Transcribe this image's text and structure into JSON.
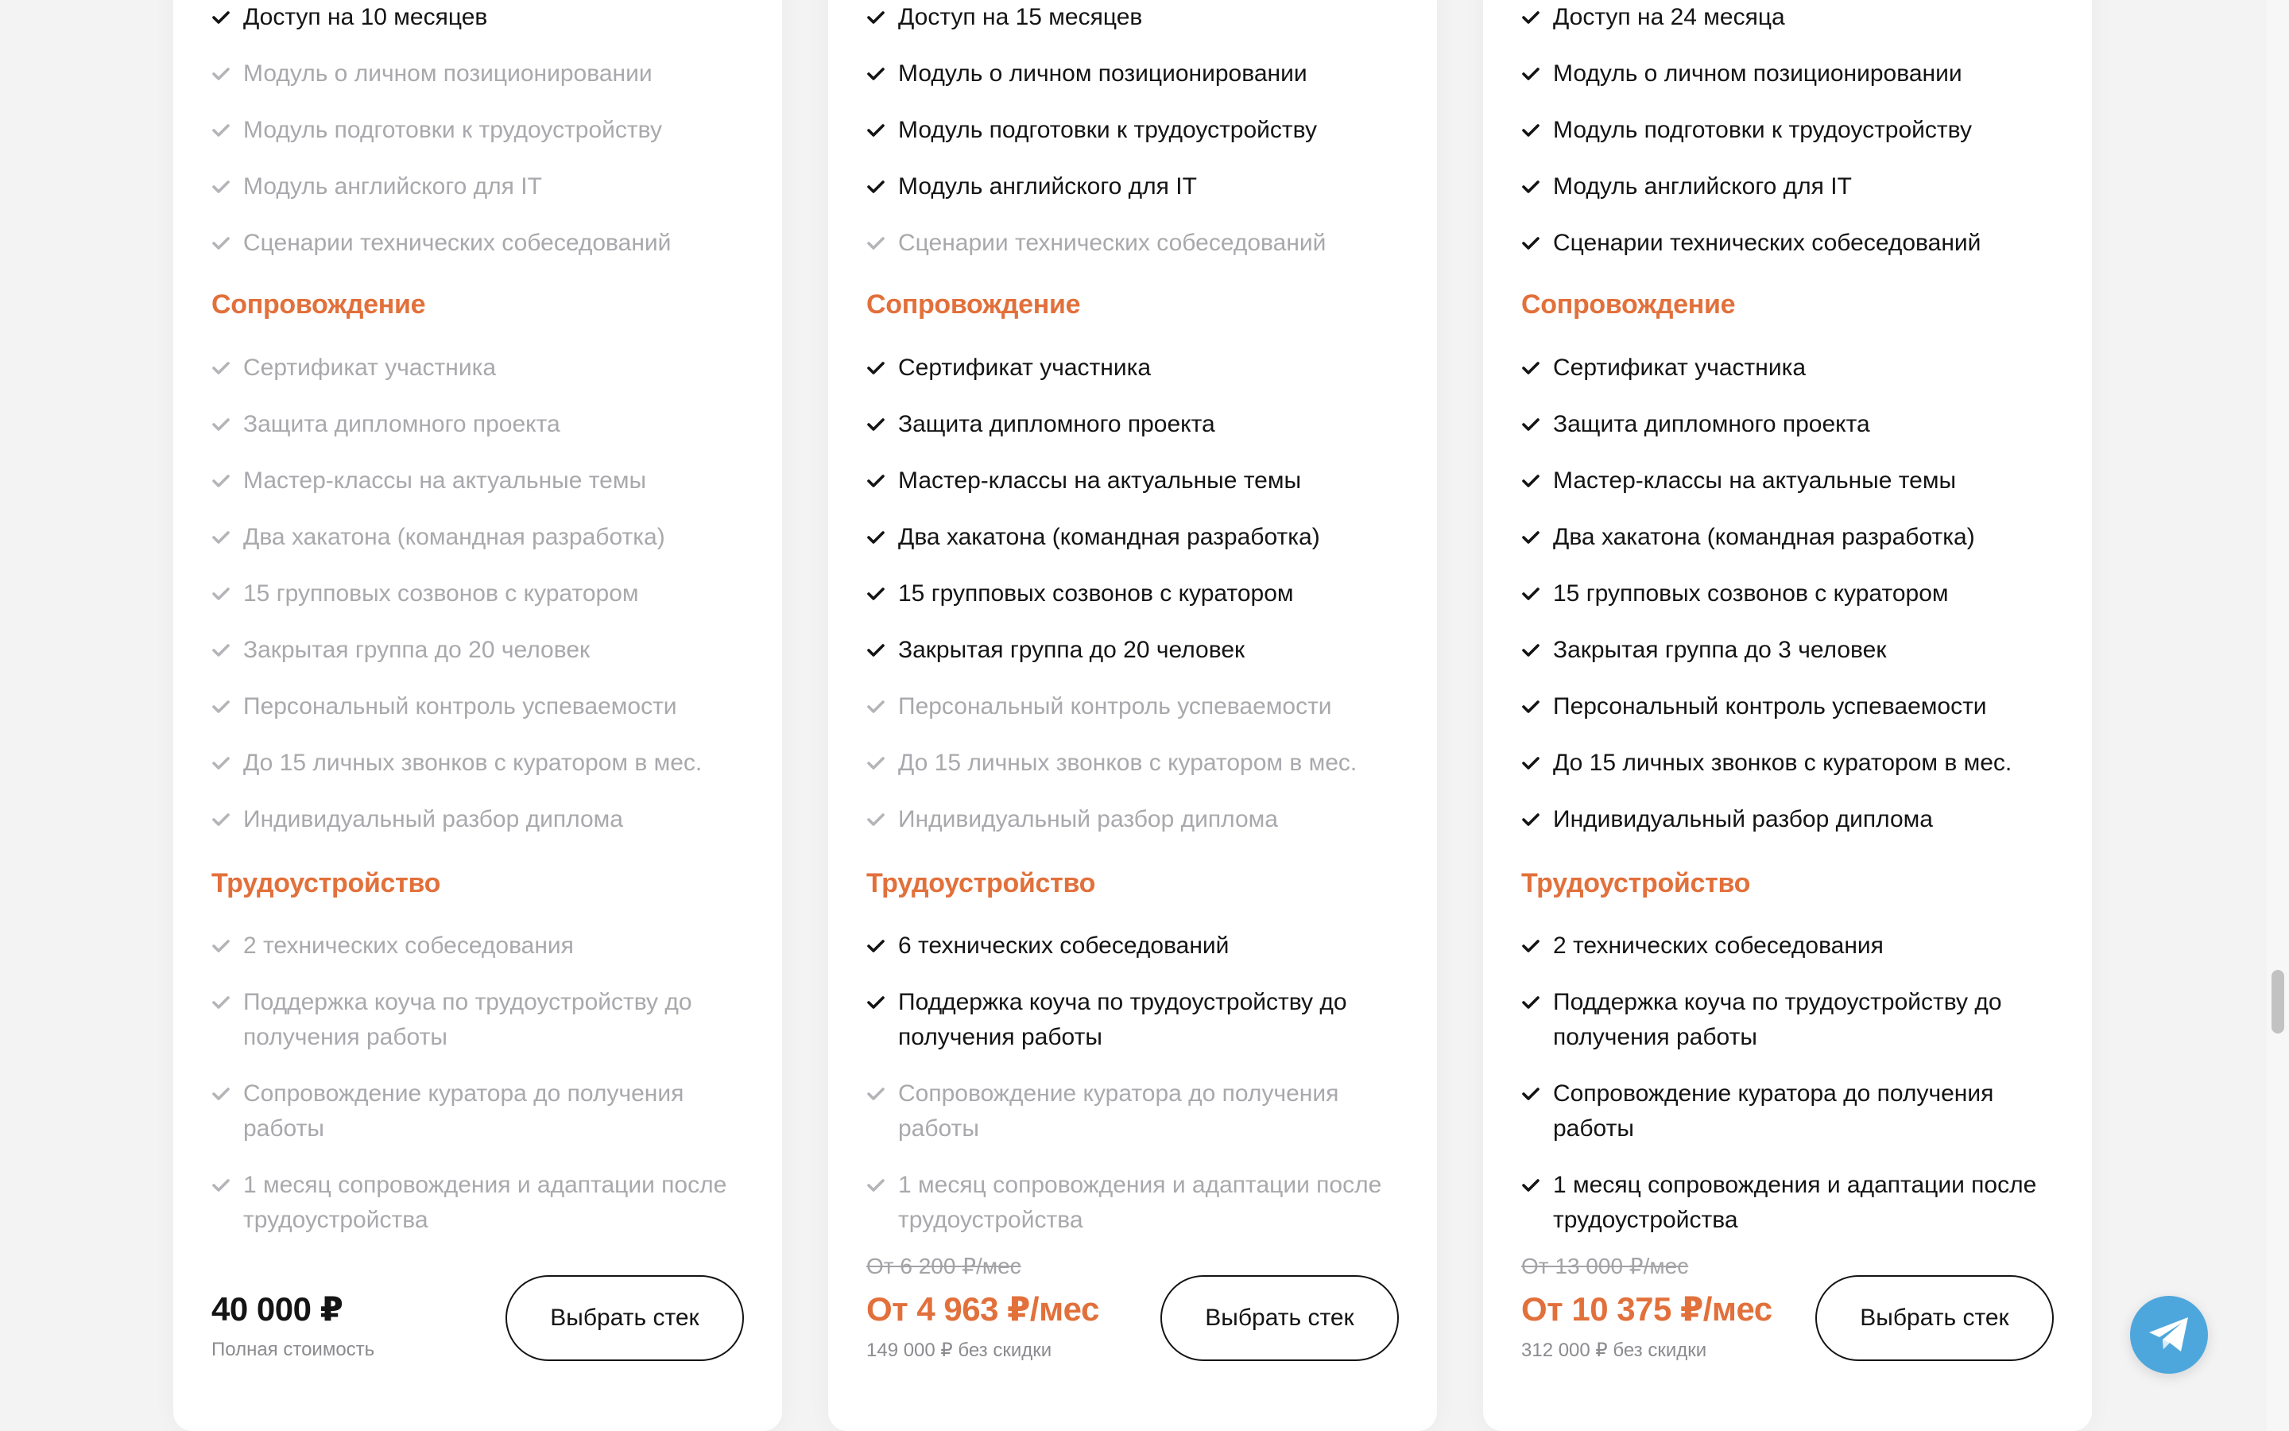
{
  "sections": {
    "support": "Сопровождение",
    "employment": "Трудоустройство"
  },
  "plans": [
    {
      "access": {
        "text": "Доступ на 10 месяцев",
        "on": true
      },
      "intro": [
        {
          "text": "Модуль о личном позиционировании",
          "on": false
        },
        {
          "text": "Модуль подготовки к трудоустройству",
          "on": false
        },
        {
          "text": "Модуль английского для IT",
          "on": false
        },
        {
          "text": "Сценарии технических собеседований",
          "on": false
        }
      ],
      "support": [
        {
          "text": "Сертификат участника",
          "on": false
        },
        {
          "text": "Защита дипломного проекта",
          "on": false
        },
        {
          "text": "Мастер-классы на актуальные темы",
          "on": false
        },
        {
          "text": "Два хакатона (командная разработка)",
          "on": false
        },
        {
          "text": "15 групповых созвонов с куратором",
          "on": false
        },
        {
          "text": "Закрытая группа до 20 человек",
          "on": false
        },
        {
          "text": "Персональный контроль успеваемости",
          "on": false
        },
        {
          "text": "До 15 личных звонков с куратором в мес.",
          "on": false
        },
        {
          "text": "Индивидуальный разбор диплома",
          "on": false
        }
      ],
      "employment": [
        {
          "text": "2 технических собеседования",
          "on": false
        },
        {
          "text": "Поддержка коуча по трудоустройству до получения работы",
          "on": false
        },
        {
          "text": "Сопровождение куратора до получения работы",
          "on": false
        },
        {
          "text": "1 месяц сопровождения и адаптации после трудоустройства",
          "on": false
        }
      ],
      "old_price": "",
      "price": "40 000 ₽",
      "price_note": "Полная стоимость",
      "button": "Выбрать стек"
    },
    {
      "access": {
        "text": "Доступ на 15 месяцев",
        "on": true
      },
      "intro": [
        {
          "text": "Модуль о личном позиционировании",
          "on": true
        },
        {
          "text": "Модуль подготовки к трудоустройству",
          "on": true
        },
        {
          "text": "Модуль английского для IT",
          "on": true
        },
        {
          "text": "Сценарии технических собеседований",
          "on": false
        }
      ],
      "support": [
        {
          "text": "Сертификат участника",
          "on": true
        },
        {
          "text": "Защита дипломного проекта",
          "on": true
        },
        {
          "text": "Мастер-классы на актуальные темы",
          "on": true
        },
        {
          "text": "Два хакатона (командная разработка)",
          "on": true
        },
        {
          "text": "15 групповых созвонов с куратором",
          "on": true
        },
        {
          "text": "Закрытая группа до 20 человек",
          "on": true
        },
        {
          "text": "Персональный контроль успеваемости",
          "on": false
        },
        {
          "text": "До 15 личных звонков с куратором в мес.",
          "on": false
        },
        {
          "text": "Индивидуальный разбор диплома",
          "on": false
        }
      ],
      "employment": [
        {
          "text": "6 технических собеседований",
          "on": true
        },
        {
          "text": "Поддержка коуча по трудоустройству до получения работы",
          "on": true
        },
        {
          "text": "Сопровождение куратора до получения работы",
          "on": false
        },
        {
          "text": "1 месяц сопровождения и адаптации после трудоустройства",
          "on": false
        }
      ],
      "old_price": "От 6 200 ₽/мес",
      "price": "От 4 963 ₽/мес",
      "price_note": "149 000 ₽ без скидки",
      "button": "Выбрать стек"
    },
    {
      "access": {
        "text": "Доступ на 24 месяца",
        "on": true
      },
      "intro": [
        {
          "text": "Модуль о личном позиционировании",
          "on": true
        },
        {
          "text": "Модуль подготовки к трудоустройству",
          "on": true
        },
        {
          "text": "Модуль английского для IT",
          "on": true
        },
        {
          "text": "Сценарии технических собеседований",
          "on": true
        }
      ],
      "support": [
        {
          "text": "Сертификат участника",
          "on": true
        },
        {
          "text": "Защита дипломного проекта",
          "on": true
        },
        {
          "text": "Мастер-классы на актуальные темы",
          "on": true
        },
        {
          "text": "Два хакатона (командная разработка)",
          "on": true
        },
        {
          "text": "15 групповых созвонов с куратором",
          "on": true
        },
        {
          "text": "Закрытая группа до 3 человек",
          "on": true
        },
        {
          "text": "Персональный контроль успеваемости",
          "on": true
        },
        {
          "text": "До 15 личных звонков с куратором в мес.",
          "on": true
        },
        {
          "text": "Индивидуальный разбор диплома",
          "on": true
        }
      ],
      "employment": [
        {
          "text": "2 технических собеседования",
          "on": true
        },
        {
          "text": "Поддержка коуча по трудоустройству до получения работы",
          "on": true
        },
        {
          "text": "Сопровождение куратора до получения работы",
          "on": true
        },
        {
          "text": "1 месяц сопровождения и адаптации после трудоустройства",
          "on": true
        }
      ],
      "old_price": "От 13 000 ₽/мес",
      "price": "От 10 375 ₽/мес",
      "price_note": "312 000 ₽ без скидки",
      "button": "Выбрать стек"
    }
  ],
  "icons": {
    "check": "check-icon",
    "telegram": "telegram-icon"
  },
  "colors": {
    "accent": "#e2703b",
    "muted": "#a9a9ad",
    "text": "#141414",
    "telegram": "#4ea7dc"
  }
}
